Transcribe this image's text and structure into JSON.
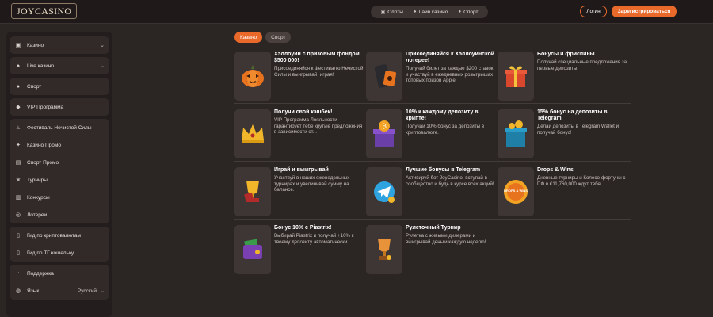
{
  "header": {
    "logo": "JOYCASINO",
    "nav": [
      {
        "label": "Слоты",
        "icon": "slot-icon"
      },
      {
        "label": "Лайв казино",
        "icon": "live-icon"
      },
      {
        "label": "Спорт",
        "icon": "sport-icon"
      }
    ],
    "login_label": "Логин",
    "register_label": "Зарегистрироваться"
  },
  "sidebar": {
    "casino": "Казино",
    "live_casino": "Live казино",
    "sport": "Спорт",
    "vip": "VIP Программа",
    "promo_items": [
      "Фестиваль Нечистой Силы",
      "Казино Промо",
      "Спорт Промо",
      "Турниры",
      "Конкурсы",
      "Лотереи"
    ],
    "guide_crypto": "Гид по криптовалютам",
    "guide_tg": "Гид по ТГ кошельку",
    "support": "Поддержка",
    "language_label": "Язык",
    "language_value": "Русский"
  },
  "filters": {
    "casino": "Казино",
    "sport": "Спорт"
  },
  "promos": [
    {
      "title": "Хэллоуин с призовым фондом $500 000!",
      "desc": "Присоединяйся к Фестивалю Нечистой Силы и выигрывай, играя!",
      "icon": "pumpkin-icon"
    },
    {
      "title": "Присоединяйся к Хэллоуинской лотерее!",
      "desc": "Получай билет за каждые $200 ставок и участвуй в ежедневных розыгрышах топовых призов Apple.",
      "icon": "phone-ticket-icon"
    },
    {
      "title": "Бонусы и фриспины",
      "desc": "Получай специальные предложения за первые депозиты.",
      "icon": "gift-icon"
    },
    {
      "title": "Получи свой кэшбек!",
      "desc": "VIP Программа Лояльности гарантирует тебе крутые предложения в зависимости от...",
      "icon": "crown-icon"
    },
    {
      "title": "10% к каждому депозиту в крипте!",
      "desc": "Получай 10% бонус за депозиты в криптовалюте.",
      "icon": "crypto-box-icon"
    },
    {
      "title": "15% бонус на депозиты в Telegram",
      "desc": "Делай депозиты в Telegram Wallet и получай бонус!",
      "icon": "wallet-box-icon"
    },
    {
      "title": "Играй и выигрывай",
      "desc": "Участвуй в наших еженедельных турнирах и увеличивай сумму на балансе.",
      "icon": "trophy-icon"
    },
    {
      "title": "Лучшие бонусы в Telegram",
      "desc": "Активируй бот JoyCasino, вступай в сообщество и будь в курсе всех акций!",
      "icon": "telegram-icon"
    },
    {
      "title": "Drops & Wins",
      "desc": "Дневные турниры и Колесо-фортуны с ПФ в €11,760,000 ждут тебя!",
      "icon": "drops-wins-icon",
      "badge": "DROPS & WINS"
    },
    {
      "title": "Бонус 10% с Piastrix!",
      "desc": "Выбирай Piastrix и получай +10% к твоему депозиту автоматически.",
      "icon": "wallet-money-icon"
    },
    {
      "title": "Рулеточный Турнир",
      "desc": "Рулетка с живыми дилерами и выигрывай деньги каждую неделю!",
      "icon": "roulette-trophy-icon"
    }
  ],
  "colors": {
    "accent": "#e8692a",
    "background": "#2b2523",
    "card_thumb": "#3e3634"
  }
}
